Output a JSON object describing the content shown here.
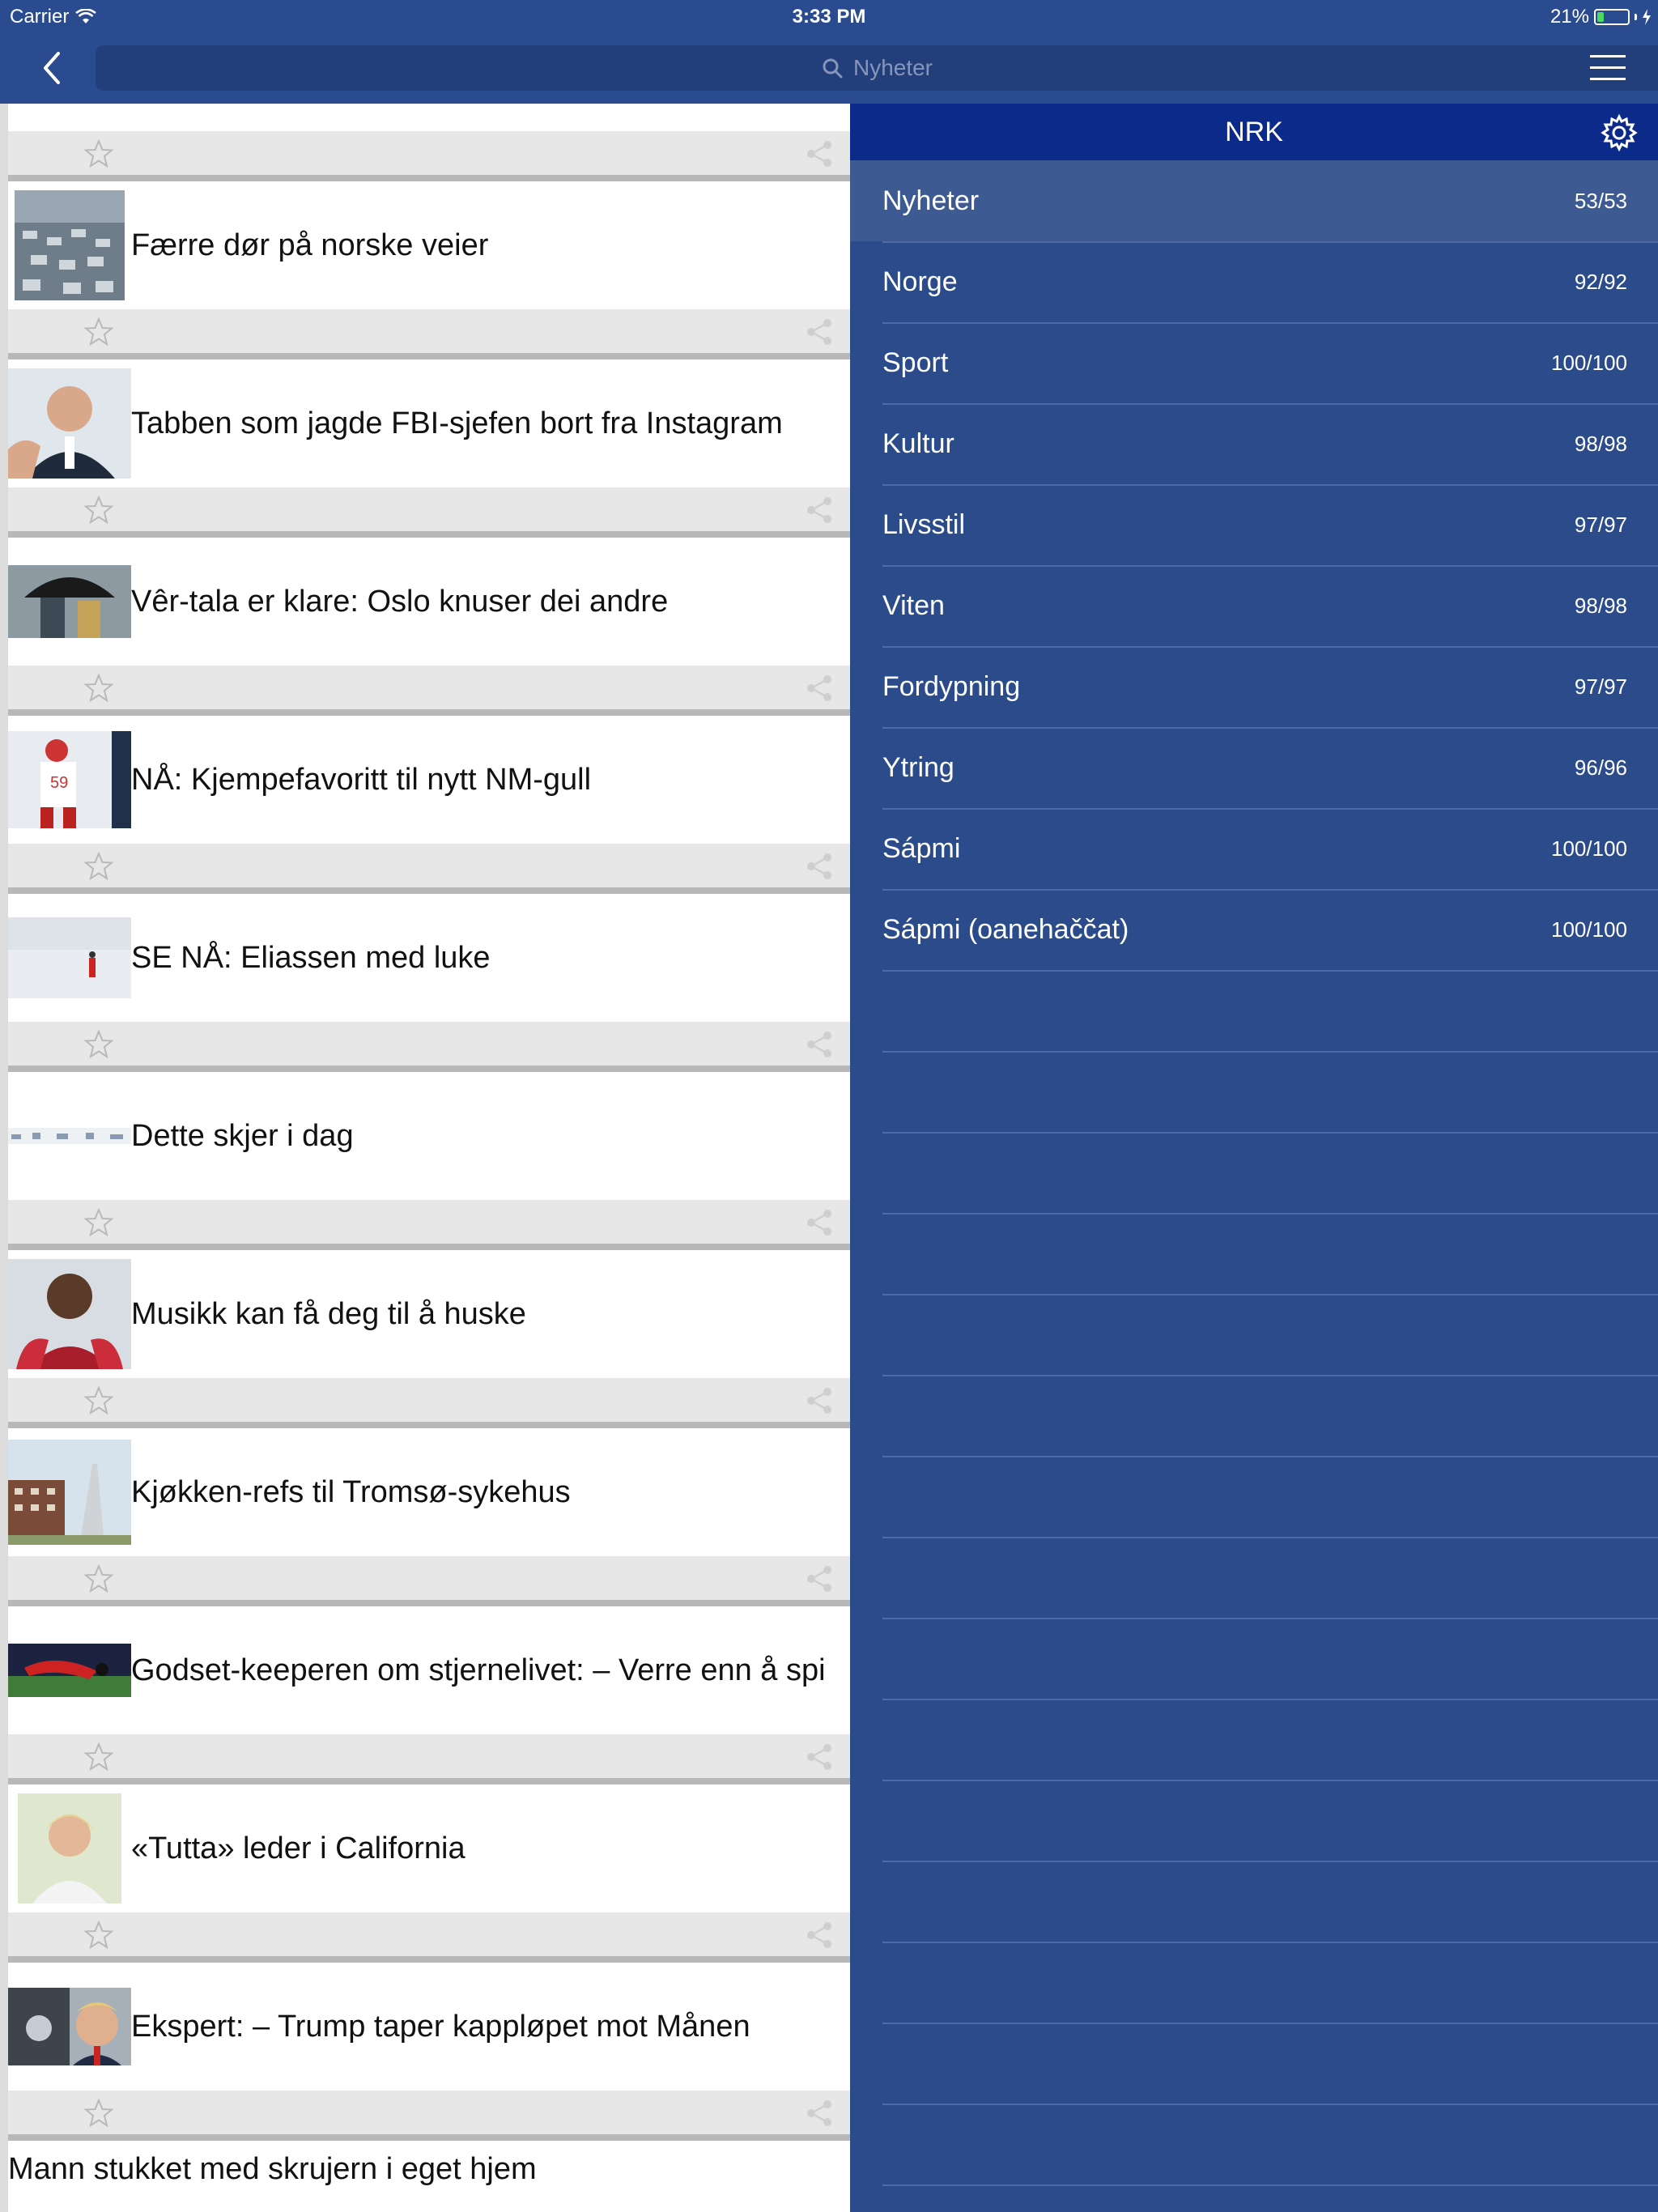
{
  "status_bar": {
    "carrier": "Carrier",
    "time": "3:33 PM",
    "battery": "21%",
    "battery_level": 0.21
  },
  "search": {
    "placeholder": "Nyheter"
  },
  "articles": [
    {
      "title": "Færre dør på norske veier"
    },
    {
      "title": "Tabben som jagde FBI-sjefen bort fra Instagram"
    },
    {
      "title": "Vêr-tala er klare: Oslo knuser dei andre"
    },
    {
      "title": "NÅ: Kjempefavoritt til nytt NM-gull"
    },
    {
      "title": "SE NÅ: Eliassen med luke"
    },
    {
      "title": "Dette skjer i dag"
    },
    {
      "title": "Musikk kan få deg til å huske"
    },
    {
      "title": "Kjøkken-refs til Tromsø-sykehus"
    },
    {
      "title": "Godset-keeperen om stjernelivet: – Verre enn å spi"
    },
    {
      "title": "«Tutta» leder i California"
    },
    {
      "title": "Ekspert: – Trump taper kappløpet mot Månen"
    },
    {
      "title": "Mann stukket med skrujern i eget hjem"
    }
  ],
  "panel": {
    "title": "NRK",
    "categories": [
      {
        "name": "Nyheter",
        "count": "53/53"
      },
      {
        "name": "Norge",
        "count": "92/92"
      },
      {
        "name": "Sport",
        "count": "100/100"
      },
      {
        "name": "Kultur",
        "count": "98/98"
      },
      {
        "name": "Livsstil",
        "count": "97/97"
      },
      {
        "name": "Viten",
        "count": "98/98"
      },
      {
        "name": "Fordypning",
        "count": "97/97"
      },
      {
        "name": "Ytring",
        "count": "96/96"
      },
      {
        "name": "Sápmi",
        "count": "100/100"
      },
      {
        "name": "Sápmi (oanehaččat)",
        "count": "100/100"
      }
    ]
  },
  "colors": {
    "nav": "#2a4b8f",
    "panel": "#2b4b8b",
    "panel_header": "#0c2a8a",
    "active_row": "#3d5a93"
  }
}
